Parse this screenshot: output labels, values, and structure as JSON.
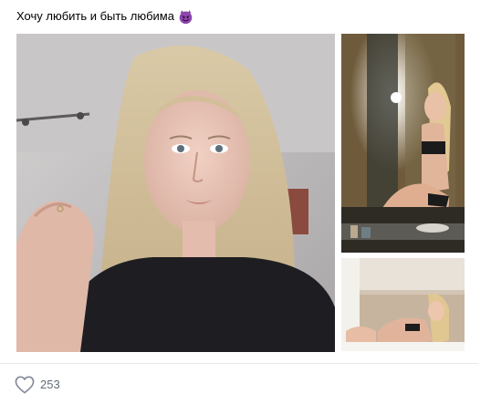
{
  "post": {
    "text": "Хочу любить и быть любима",
    "emoji": "smiling-devil-emoji",
    "photos": [
      {
        "name": "selfie-photo",
        "icon": "photo-thumbnail"
      },
      {
        "name": "mirror-selfie-photo",
        "icon": "photo-thumbnail"
      },
      {
        "name": "bed-photo",
        "icon": "photo-thumbnail"
      }
    ]
  },
  "actions": {
    "like_icon": "heart-outline-icon",
    "like_count": "253"
  },
  "colors": {
    "text": "#000000",
    "muted": "#626d7a",
    "divider": "#e7e8ec",
    "emoji_purple": "#8e44ad"
  }
}
